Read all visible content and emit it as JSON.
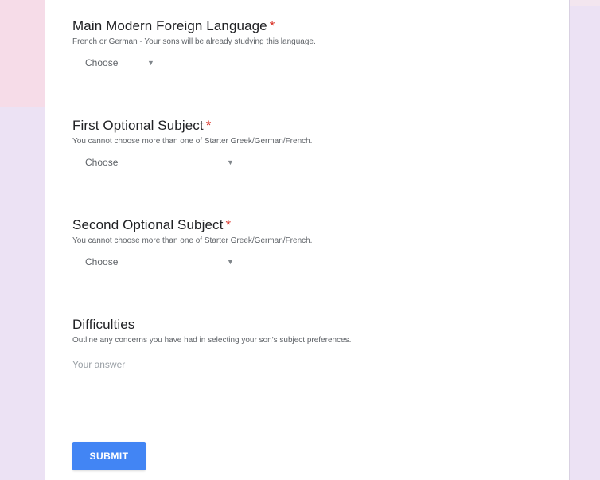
{
  "form": {
    "questions": [
      {
        "title": "Main Modern Foreign Language",
        "required_mark": "*",
        "description": "French or German - Your sons will be already studying this language.",
        "dropdown_value": "Choose"
      },
      {
        "title": "First Optional Subject",
        "required_mark": "*",
        "description": "You cannot choose more than one of Starter Greek/German/French.",
        "dropdown_value": "Choose"
      },
      {
        "title": "Second Optional Subject",
        "required_mark": "*",
        "description": "You cannot choose more than one of Starter Greek/German/French.",
        "dropdown_value": "Choose"
      },
      {
        "title": "Difficulties",
        "description": "Outline any concerns you have had in selecting your son's subject preferences.",
        "answer_placeholder": "Your answer"
      }
    ],
    "submit_label": "SUBMIT"
  },
  "colors": {
    "accent": "#4285f4",
    "required": "#d93025",
    "background": "#ece2f4"
  },
  "icons": {
    "dropdown_arrow": "triangle-down-icon"
  }
}
